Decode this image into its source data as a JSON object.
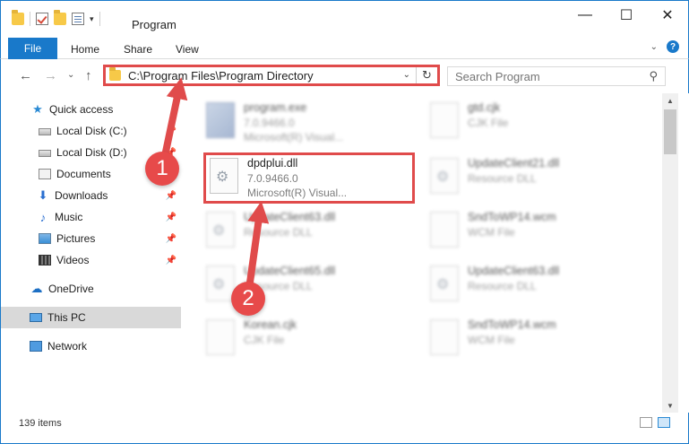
{
  "window": {
    "title": "Program",
    "controls": {
      "minimize": "—",
      "maximize": "☐",
      "close": "✕"
    }
  },
  "ribbon": {
    "tabs": [
      "File",
      "Home",
      "Share",
      "View"
    ],
    "help": "?"
  },
  "nav": {
    "back": "←",
    "forward": "→",
    "recent": "⌄",
    "up": "↑"
  },
  "address": {
    "path": "C:\\Program Files\\Program Directory",
    "dropdown": "⌄",
    "refresh": "↻"
  },
  "search": {
    "placeholder": "Search Program",
    "icon": "search-icon"
  },
  "sidebar": {
    "items": [
      {
        "label": "Quick access",
        "icon": "star-icon",
        "pinned": false
      },
      {
        "label": "Local Disk (C:)",
        "icon": "drive-icon",
        "pinned": true
      },
      {
        "label": "Local Disk (D:)",
        "icon": "drive-icon",
        "pinned": true
      },
      {
        "label": "Documents",
        "icon": "documents-icon",
        "pinned": true
      },
      {
        "label": "Downloads",
        "icon": "downloads-icon",
        "pinned": true
      },
      {
        "label": "Music",
        "icon": "music-icon",
        "pinned": true
      },
      {
        "label": "Pictures",
        "icon": "pictures-icon",
        "pinned": true
      },
      {
        "label": "Videos",
        "icon": "videos-icon",
        "pinned": true
      },
      {
        "label": "OneDrive",
        "icon": "onedrive-icon",
        "pinned": false
      },
      {
        "label": "This PC",
        "icon": "this-pc-icon",
        "pinned": false,
        "selected": true
      },
      {
        "label": "Network",
        "icon": "network-icon",
        "pinned": false
      }
    ],
    "pin_glyph": "📌"
  },
  "files": [
    {
      "name": "program.exe",
      "line1": "7.0.9466.0",
      "line2": "Microsoft(R) Visual...",
      "icon": "exe-icon"
    },
    {
      "name": "gtd.cjk",
      "line1": "CJK File",
      "line2": "",
      "icon": "file-icon"
    },
    {
      "name": "dpdplui.dll",
      "line1": "7.0.9466.0",
      "line2": "Microsoft(R) Visual...",
      "icon": "dll-gear-icon"
    },
    {
      "name": "UpdateClient21.dll",
      "line1": "Resource DLL",
      "line2": "",
      "icon": "dll-gear-icon"
    },
    {
      "name": "UpdateClient63.dll",
      "line1": "Resource DLL",
      "line2": "",
      "icon": "dll-gear-icon"
    },
    {
      "name": "SndToWP14.wcm",
      "line1": "WCM File",
      "line2": "",
      "icon": "file-icon"
    },
    {
      "name": "UpdateClient65.dll",
      "line1": "Resource DLL",
      "line2": "",
      "icon": "dll-gear-icon"
    },
    {
      "name": "UpdateClient63.dll",
      "line1": "Resource DLL",
      "line2": "",
      "icon": "dll-gear-icon"
    },
    {
      "name": "Korean.cjk",
      "line1": "CJK File",
      "line2": "",
      "icon": "file-icon"
    },
    {
      "name": "SndToWP14.wcm",
      "line1": "WCM File",
      "line2": "",
      "icon": "file-icon"
    }
  ],
  "status": {
    "count": "139 items"
  },
  "annotations": {
    "step1": "1",
    "step2": "2",
    "color": "#e04b4b"
  },
  "colors": {
    "accent": "#1979ca",
    "highlight": "#e04b4b",
    "selected": "#d9d9d9"
  }
}
